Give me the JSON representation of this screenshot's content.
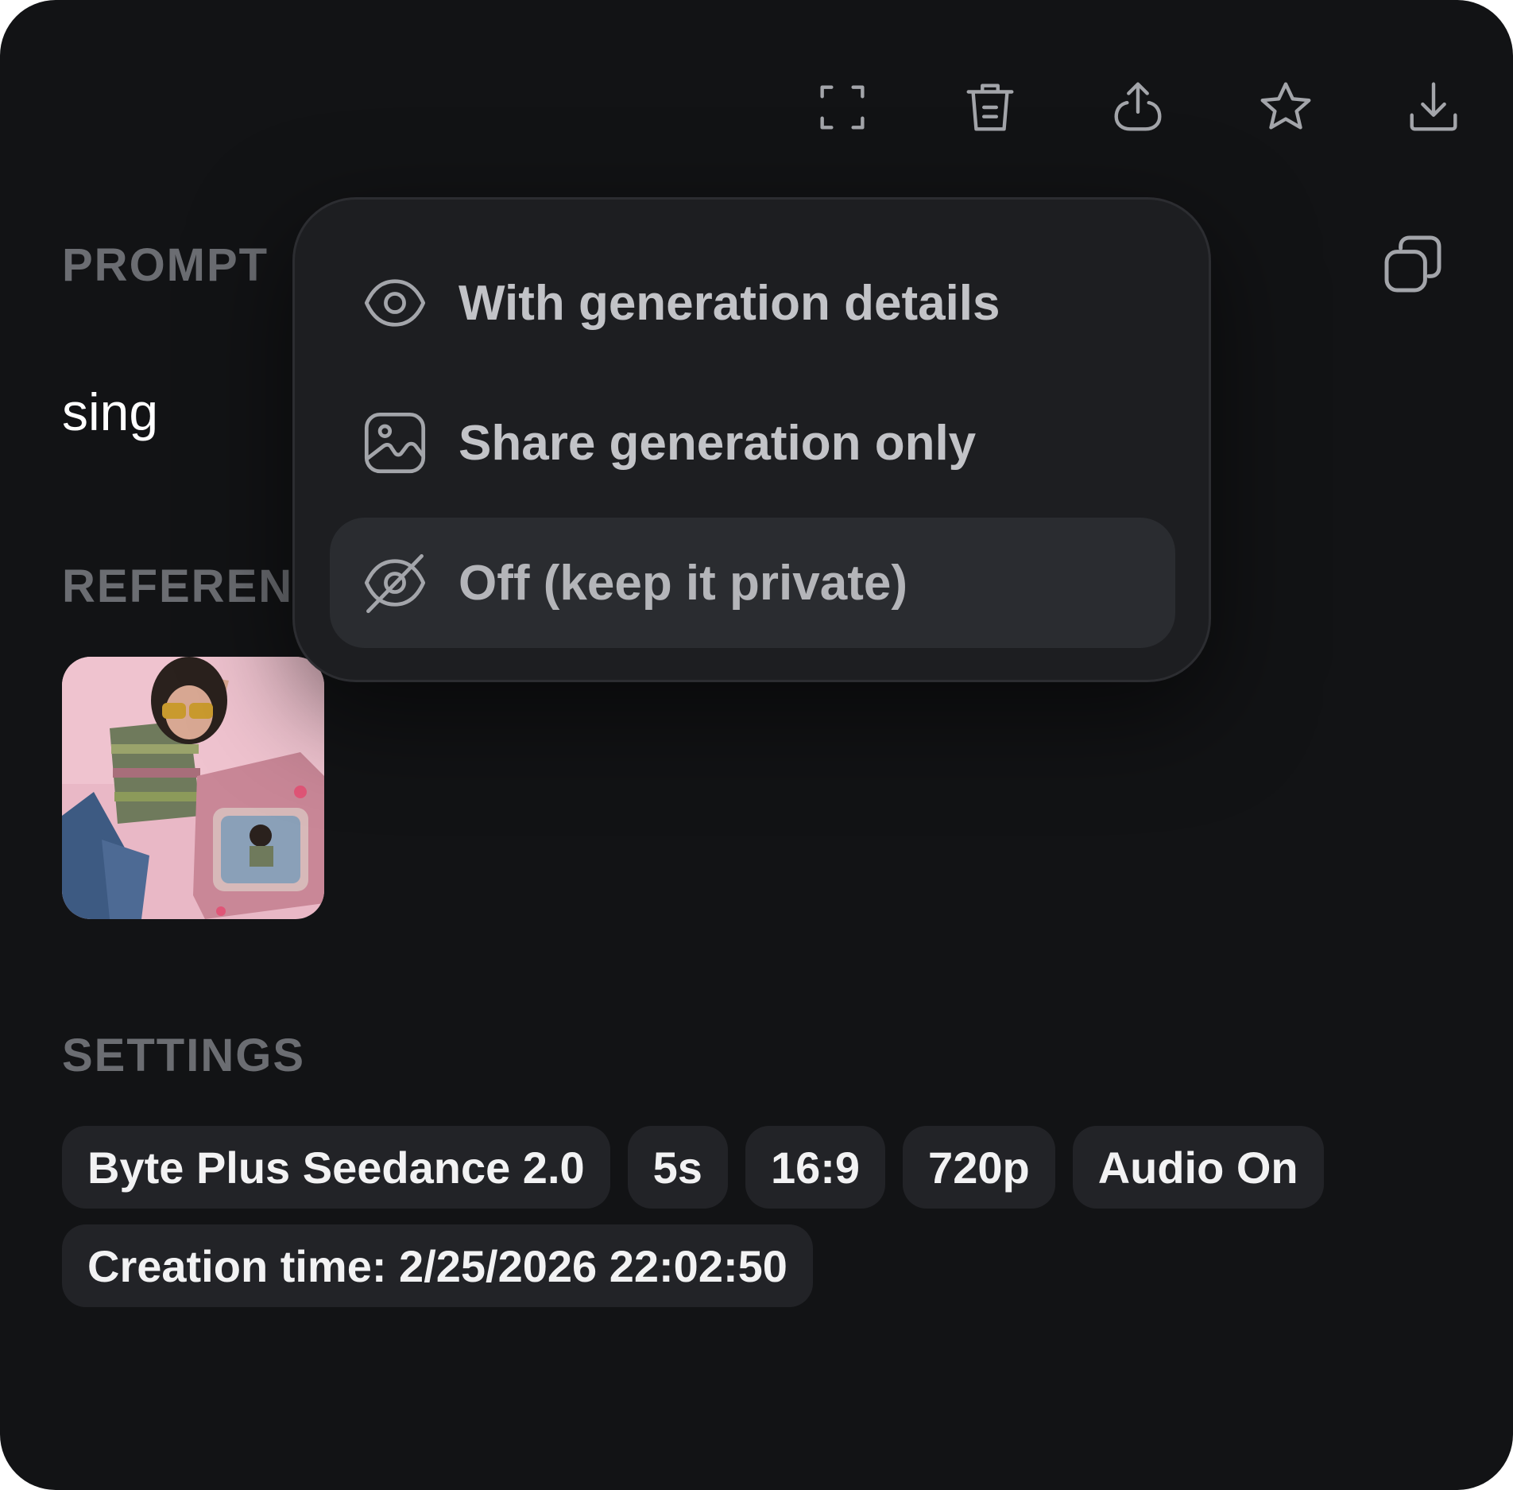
{
  "toolbar": {
    "buttons": [
      {
        "icon": "fullscreen-icon"
      },
      {
        "icon": "trash-icon"
      },
      {
        "icon": "share-icon"
      },
      {
        "icon": "star-icon"
      },
      {
        "icon": "download-icon"
      }
    ]
  },
  "prompt": {
    "label": "PROMPT",
    "text": "sing",
    "copy_icon": "copy-icon"
  },
  "references": {
    "label": "REFERENC"
  },
  "settings": {
    "label": "SETTINGS",
    "chips": [
      "Byte Plus Seedance 2.0",
      "5s",
      "16:9",
      "720p",
      "Audio On"
    ],
    "creation_time": "Creation time: 2/25/2026 22:02:50"
  },
  "share_menu": {
    "items": [
      {
        "label": "With generation details",
        "icon": "eye-icon",
        "active": false
      },
      {
        "label": "Share generation only",
        "icon": "image-icon",
        "active": false
      },
      {
        "label": "Off (keep it private)",
        "icon": "eye-off-icon",
        "active": true
      }
    ]
  },
  "colors": {
    "background": "#121315",
    "chip_bg": "#222327",
    "menu_bg": "#1d1e21",
    "menu_active_bg": "#2a2c30",
    "label_gray": "#6b6d72",
    "icon_gray": "#a3a5aa"
  }
}
